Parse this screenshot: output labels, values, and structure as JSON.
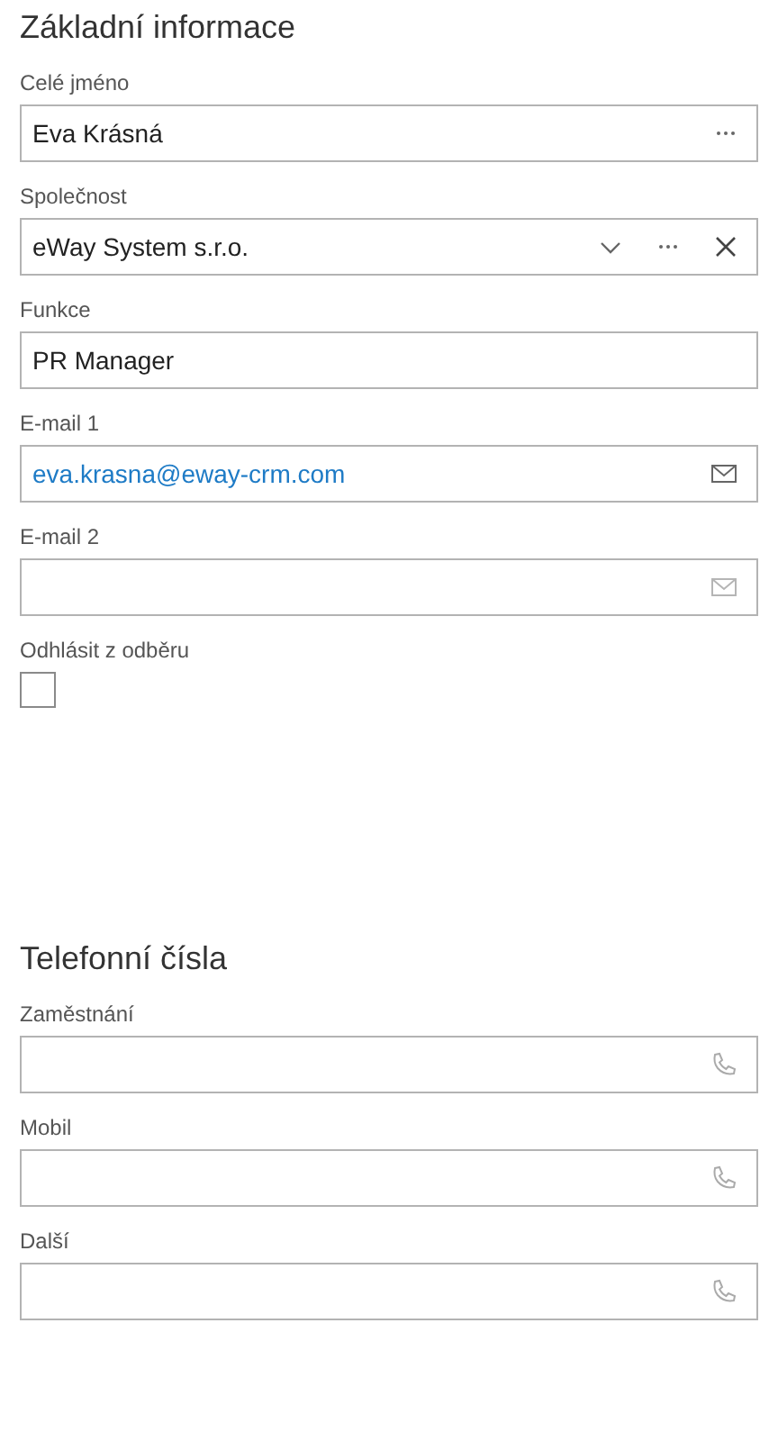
{
  "sections": [
    {
      "title": "Základní informace",
      "fields": [
        {
          "kind": "name",
          "label": "Celé jméno",
          "value": "Eva Krásná"
        },
        {
          "kind": "lookup",
          "label": "Společnost",
          "value": "eWay System s.r.o."
        },
        {
          "kind": "text",
          "label": "Funkce",
          "value": "PR Manager"
        },
        {
          "kind": "email",
          "label": "E-mail 1",
          "value": "eva.krasna@eway-crm.com"
        },
        {
          "kind": "email",
          "label": "E-mail 2"
        },
        {
          "kind": "checkbox",
          "label": "Odhlásit z odběru",
          "checked": false
        }
      ]
    },
    {
      "title": "Telefonní čísla",
      "fields": [
        {
          "kind": "phone",
          "label": "Zaměstnání"
        },
        {
          "kind": "phone",
          "label": "Mobil"
        },
        {
          "kind": "phone",
          "label": "Další"
        }
      ]
    }
  ]
}
